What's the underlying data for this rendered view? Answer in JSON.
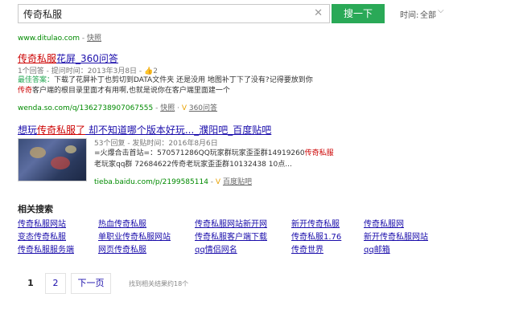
{
  "search": {
    "value": "传奇私服",
    "button": "搜一下",
    "time_label": "时间:",
    "time_value": "全部"
  },
  "results": [
    {
      "url": "www.ditulao.com",
      "sep": " - ",
      "snapshot": "快照"
    },
    {
      "title_red": "传奇私服",
      "title_rest": "花屏_360问答",
      "meta": "1个回答 - 提问时间：2013年3月8日 - ",
      "likes": "2",
      "best_label": "最佳答案：",
      "line1": "下载了花屏补丁也剪切到DATA文件夹 还是没用 地图补丁下了没有?记得要放到你",
      "line2_red": "传奇",
      "line2": "客户端的根目录里面才有用啊,也就是说你在客户端里面建一个",
      "url": "wenda.so.com/q/1362738907067555",
      "sep": " - ",
      "snapshot": "快照",
      "source": "360问答"
    },
    {
      "title": "想玩",
      "title_red": "传奇私服了",
      "title_rest": " 却不知道哪个版本好玩..._濮阳吧_百度贴吧",
      "meta": "53个回复 - 发贴时间：2016年8月6日",
      "line1": "=火爆合击首站=：570571286QQ玩家群玩家歪歪群14919260",
      "line1_red": "传奇私服",
      "line2": "老玩家qq群 72684622传奇老玩家歪歪群10132438 10点...",
      "url": "tieba.baidu.com/p/2199585114",
      "sep": " - ",
      "source": "百度贴吧"
    }
  ],
  "related": {
    "title": "相关搜索",
    "items": [
      "传奇私服网站",
      "热血传奇私服",
      "传奇私服网站新开网",
      "新开传奇私服",
      "传奇私服网",
      "变态传奇私服",
      "单职业传奇私服网站",
      "传奇私服客户端下载",
      "传奇私服1.76",
      "新开传奇私服网站",
      "传奇私服服务端",
      "网页传奇私服",
      "qq情侣网名",
      "传奇世界",
      "qq邮箱"
    ]
  },
  "pagination": {
    "page1": "1",
    "page2": "2",
    "next": "下一页",
    "count": "找到相关结果约18个"
  },
  "colors": {
    "accent": "#2aa957",
    "link": "#1a0dab",
    "url": "#008a00",
    "highlight": "#cc0000"
  },
  "icons": [
    "clear-icon",
    "chevron-down-icon",
    "thumbs-up-icon",
    "result-thumbnail"
  ]
}
